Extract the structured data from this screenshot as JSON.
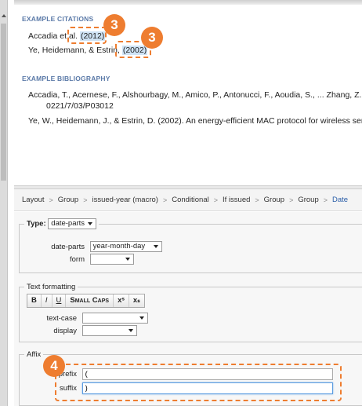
{
  "preview": {
    "citations_title": "EXAMPLE CITATIONS",
    "citations": [
      {
        "prefix": "Accadia et al. ",
        "year": "(2012)"
      },
      {
        "prefix": "Ye, Heidemann, & Estrin, ",
        "year": "(2002)"
      }
    ],
    "bibliography_title": "EXAMPLE BIBLIOGRAPHY",
    "bibliography": [
      {
        "line1": "Accadia, T., Acernese, F., Alshourbagy, M., Amico, P., Antonucci, F., Aoudia, S., ... Zhang, Z.",
        "line2": "0221/7/03/P03012"
      },
      {
        "line1": "Ye, W., Heidemann, J., & Estrin, D. (2002). An energy-efficient MAC protocol for wireless sen"
      }
    ]
  },
  "breadcrumb": [
    "Layout",
    "Group",
    "issued-year (macro)",
    "Conditional",
    "If issued",
    "Group",
    "Group",
    "Date"
  ],
  "type_panel": {
    "legend": "Type:",
    "type_value": "date-parts",
    "date_parts_label": "date-parts",
    "date_parts_value": "year-month-day",
    "form_label": "form",
    "form_value": ""
  },
  "text_formatting": {
    "legend": "Text formatting",
    "buttons": [
      "B",
      "I",
      "U",
      "Small Caps",
      "xˢ",
      "xₛ"
    ],
    "text_case_label": "text-case",
    "text_case_value": "",
    "display_label": "display",
    "display_value": ""
  },
  "affixes": {
    "legend": "Affix",
    "prefix_label": "prefix",
    "prefix_value": "(",
    "suffix_label": "suffix",
    "suffix_value": ")"
  },
  "annotations": {
    "badge_citation_1": "3",
    "badge_citation_2": "3",
    "badge_affixes": "4",
    "color": "#ee7d30"
  }
}
